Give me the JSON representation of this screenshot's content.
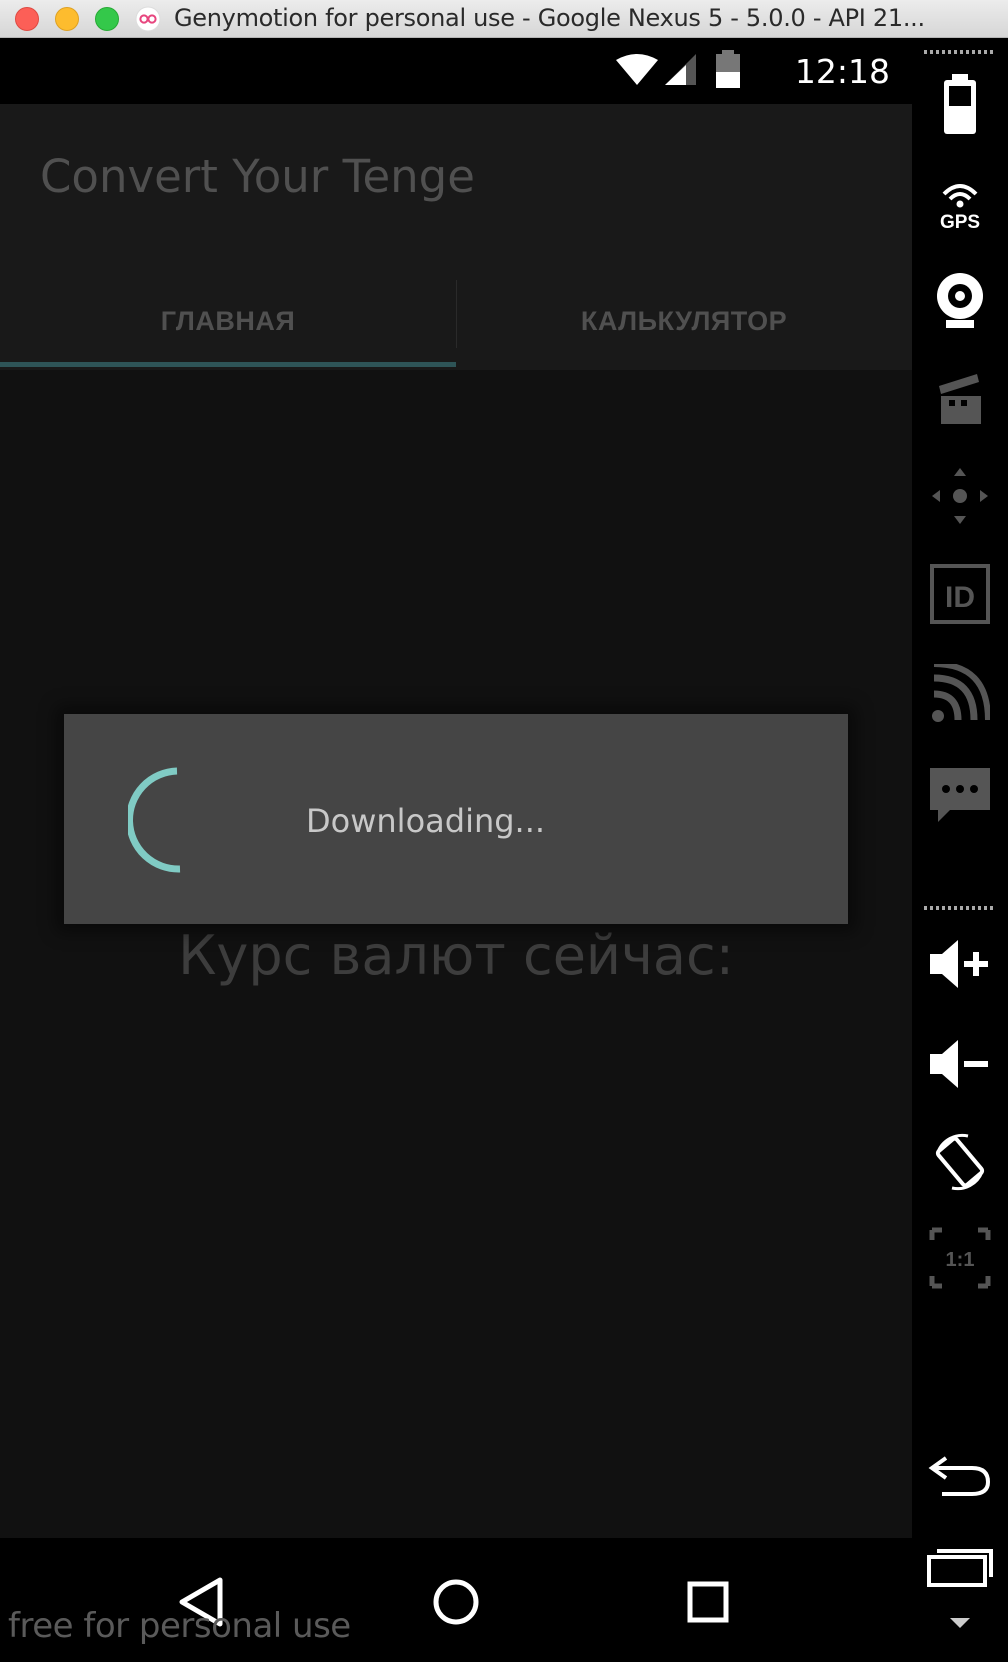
{
  "window": {
    "title": "Genymotion for personal use - Google Nexus 5 - 5.0.0 - API 21..."
  },
  "statusbar": {
    "time": "12:18",
    "icons": [
      "wifi-icon",
      "signal-icon",
      "battery-icon"
    ]
  },
  "app": {
    "title": "Convert Your Tenge",
    "tabs": [
      {
        "label": "ГЛАВНАЯ",
        "selected": true
      },
      {
        "label": "КАЛЬКУЛЯТОР",
        "selected": false
      }
    ],
    "rates_heading": "Курс валют сейчас:"
  },
  "dialog": {
    "message": "Downloading..."
  },
  "navbar": {
    "buttons": [
      "back-icon",
      "home-icon",
      "recents-icon"
    ]
  },
  "watermark": "free for personal use",
  "sidebar": {
    "gps_label": "GPS",
    "id_label": "ID",
    "scale_label": "1:1",
    "tools": [
      "battery-icon",
      "gps-icon",
      "webcam-icon",
      "screencast-icon",
      "dpad-icon",
      "device-id-icon",
      "network-icon",
      "sms-icon",
      "volume-up-icon",
      "volume-down-icon",
      "rotate-icon",
      "scale-icon",
      "back-icon",
      "recents-icon",
      "menu-icon"
    ]
  },
  "colors": {
    "accent": "#80cbc4",
    "tab_indicator": "#2e5457",
    "dialog_bg": "#454545",
    "app_bg": "#111111"
  }
}
